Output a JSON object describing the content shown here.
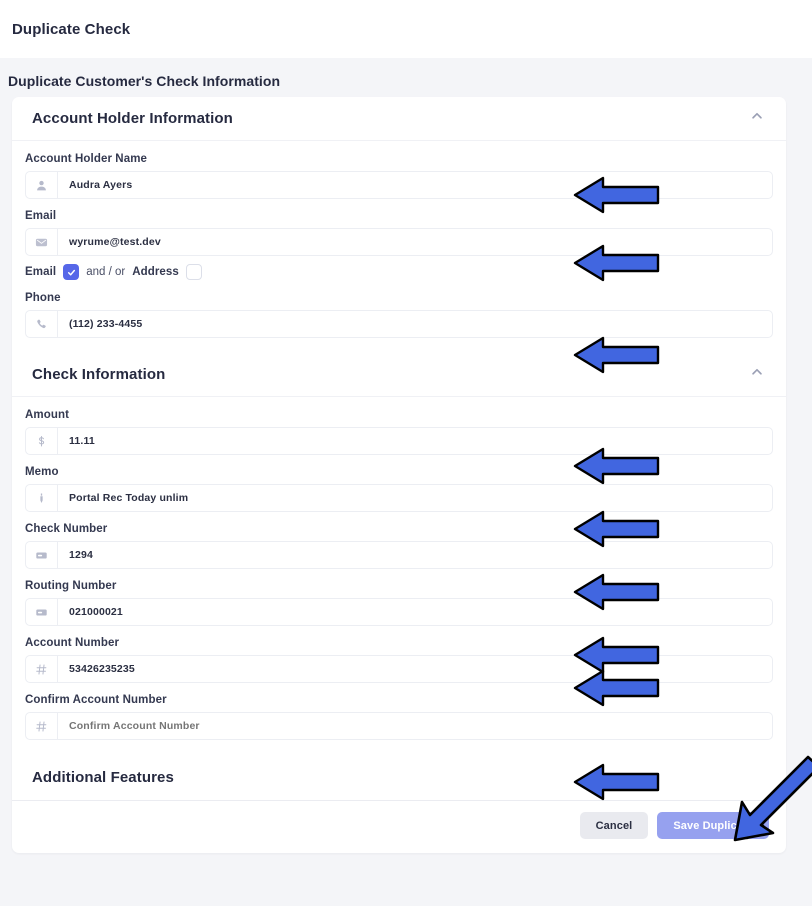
{
  "header": {
    "title": "Duplicate Check"
  },
  "sub_header": {
    "title": "Duplicate Customer's Check Information"
  },
  "sections": {
    "account_holder": {
      "title": "Account Holder Information",
      "collapse_icon": "chevron-up-icon",
      "fields": {
        "name": {
          "label": "Account Holder Name",
          "icon": "person-icon",
          "value": "Audra Ayers",
          "placeholder": "Account Holder Name"
        },
        "email": {
          "label": "Email",
          "icon": "envelope-icon",
          "value": "wyrume@test.dev",
          "placeholder": "Email"
        },
        "phone": {
          "label": "Phone",
          "icon": "phone-icon",
          "value": "(112) 233-4455",
          "placeholder": "Phone"
        }
      },
      "contact_toggle": {
        "email_label": "Email",
        "email_checked": true,
        "conjunction": "and / or",
        "address_label": "Address",
        "address_checked": false
      }
    },
    "check_information": {
      "title": "Check Information",
      "collapse_icon": "chevron-up-icon",
      "fields": {
        "amount": {
          "label": "Amount",
          "icon": "dollar-icon",
          "value": "11.11",
          "placeholder": "Amount"
        },
        "memo": {
          "label": "Memo",
          "icon": "pen-icon",
          "value": "Portal Rec Today unlim",
          "placeholder": "Memo"
        },
        "check_number": {
          "label": "Check Number",
          "icon": "check-card-icon",
          "value": "1294",
          "placeholder": "Check Number"
        },
        "routing_number": {
          "label": "Routing Number",
          "icon": "check-card-icon",
          "value": "021000021",
          "placeholder": "Routing Number"
        },
        "account_number": {
          "label": "Account Number",
          "icon": "hash-icon",
          "value": "53426235235",
          "placeholder": "Account Number"
        },
        "confirm_account_number": {
          "label": "Confirm Account Number",
          "icon": "hash-icon",
          "value": "",
          "placeholder": "Confirm Account Number"
        }
      }
    },
    "additional_features": {
      "title": "Additional Features"
    }
  },
  "footer": {
    "cancel_label": "Cancel",
    "save_label": "Save Duplicate"
  },
  "colors": {
    "accent": "#5667e8",
    "save_button": "#96a1ef",
    "cancel_button": "#e9eaef",
    "page_background": "#f4f5f8",
    "card_background": "#ffffff",
    "text": "#262a40",
    "annotation_arrow": "#4166e0"
  },
  "annotations": {
    "arrow_count": 9,
    "note": "blue arrows highlighting form inputs and the save button"
  }
}
